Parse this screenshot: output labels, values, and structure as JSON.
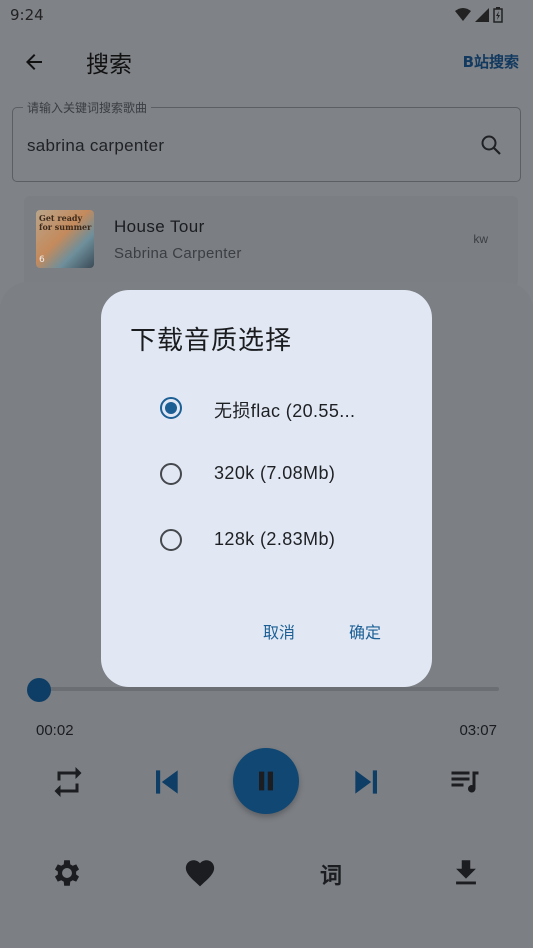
{
  "status_bar": {
    "time": "9:24"
  },
  "app_bar": {
    "title": "搜索",
    "bili_search": "B站搜索"
  },
  "search": {
    "label": "请输入关键词搜索歌曲",
    "value": "sabrina carpenter"
  },
  "results": [
    {
      "title": "House Tour",
      "artist": "Sabrina Carpenter",
      "source": "kw",
      "cover_text": "Get ready for summer",
      "cover_badge": "6"
    }
  ],
  "player": {
    "current_time": "00:02",
    "total_time": "03:07",
    "progress": 0.01,
    "lyrics_label": "词"
  },
  "dialog": {
    "title": "下载音质选择",
    "options": [
      {
        "label": "无损flac (20.55...",
        "selected": true
      },
      {
        "label": "320k (7.08Mb)",
        "selected": false
      },
      {
        "label": "128k (2.83Mb)",
        "selected": false
      }
    ],
    "cancel": "取消",
    "confirm": "确定"
  },
  "colors": {
    "accent": "#1c5f95",
    "scrim_bg": "#7f8287",
    "dialog_bg": "#e1e8f3",
    "play_bg": "#114773"
  }
}
